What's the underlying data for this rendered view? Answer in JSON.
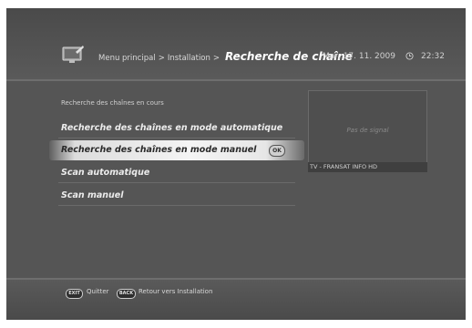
{
  "header": {
    "breadcrumb_root": "Menu principal",
    "breadcrumb_sep": ">",
    "breadcrumb_section": "Installation",
    "page_title": "Recherche de chaîne",
    "date": "Mar, 17. 11. 2009",
    "time": "22:32",
    "app_icon": "tv-settings-icon",
    "clock_icon": "clock-icon"
  },
  "status_text": "Recherche des chaînes en cours",
  "menu": {
    "items": [
      {
        "label": "Recherche des chaînes en mode automatique",
        "selected": false
      },
      {
        "label": "Recherche des chaînes en mode manuel",
        "selected": true,
        "badge": "OK"
      },
      {
        "label": "Scan automatique",
        "selected": false
      },
      {
        "label": "Scan manuel",
        "selected": false
      }
    ]
  },
  "preview": {
    "no_signal_text": "Pas de signal",
    "channel": "TV - FRANSAT INFO HD"
  },
  "footer": {
    "exit_key": "EXIT",
    "exit_label": "Quitter",
    "back_key": "BACK",
    "back_label": "Retour vers Installation"
  },
  "colors": {
    "background": "#555555",
    "highlight": "#f0f0f0",
    "text": "#ececec"
  }
}
